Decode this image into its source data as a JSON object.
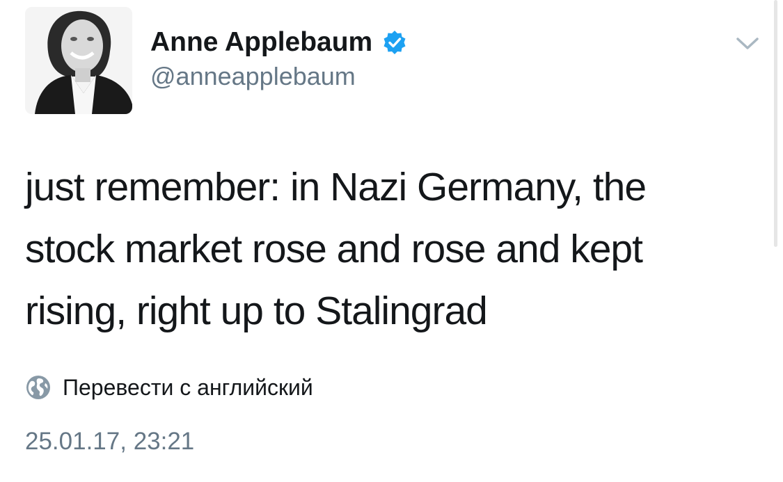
{
  "tweet": {
    "author_name": "Anne Applebaum",
    "author_handle": "@anneapplebaum",
    "verified": true,
    "text_lines": [
      "just remember: in Nazi Germany, the",
      "stock market rose and rose and kept",
      "rising, right up to Stalingrad"
    ],
    "translate_label": "Перевести с английский",
    "timestamp": "25.01.17, 23:21"
  },
  "icons": {
    "verified": "verified-badge-icon",
    "menu": "chevron-down-icon",
    "translate": "globe-icon"
  },
  "colors": {
    "text_primary": "#14171a",
    "text_secondary": "#657786",
    "verified_blue": "#1da1f2",
    "icon_gray": "#8899a6"
  }
}
